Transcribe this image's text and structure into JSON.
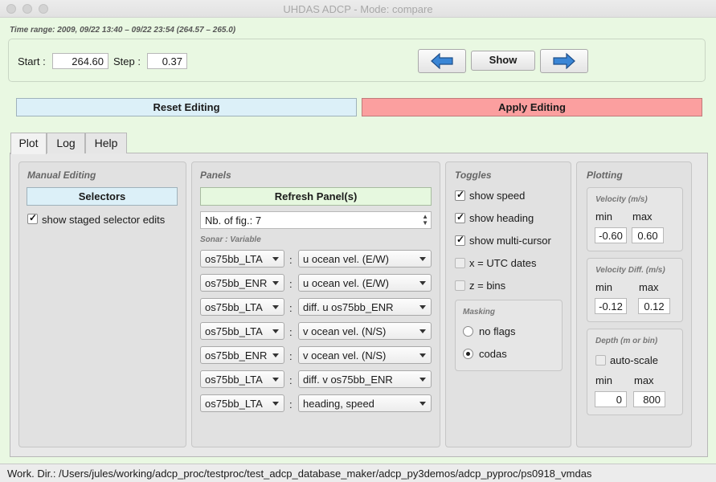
{
  "window": {
    "title": "UHDAS ADCP - Mode: compare"
  },
  "time_range": "Time range: 2009, 09/22 13:40 – 09/22 23:54 (264.57 – 265.0)",
  "nav": {
    "start_label": "Start :",
    "start_value": "264.60",
    "step_label": "Step :",
    "step_value": "0.37",
    "prev_icon": "left-arrow-icon",
    "show_label": "Show",
    "next_icon": "right-arrow-icon"
  },
  "actions": {
    "reset_label": "Reset Editing",
    "apply_label": "Apply Editing"
  },
  "tabs": [
    "Plot",
    "Log",
    "Help"
  ],
  "manual_editing": {
    "title": "Manual Editing",
    "selectors_label": "Selectors",
    "staged_label": "show staged selector edits",
    "staged_checked": true
  },
  "panels": {
    "title": "Panels",
    "refresh_label": "Refresh Panel(s)",
    "nb_fig": "Nb. of fig.: 7",
    "header": "Sonar  :  Variable",
    "rows": [
      {
        "sonar": "os75bb_LTA",
        "variable": "u ocean vel. (E/W)"
      },
      {
        "sonar": "os75bb_ENR",
        "variable": "u ocean vel. (E/W)"
      },
      {
        "sonar": "os75bb_LTA",
        "variable": "diff.  u os75bb_ENR"
      },
      {
        "sonar": "os75bb_LTA",
        "variable": "v ocean vel. (N/S)"
      },
      {
        "sonar": "os75bb_ENR",
        "variable": "v ocean vel. (N/S)"
      },
      {
        "sonar": "os75bb_LTA",
        "variable": "diff.  v os75bb_ENR"
      },
      {
        "sonar": "os75bb_LTA",
        "variable": "heading, speed"
      }
    ]
  },
  "toggles": {
    "title": "Toggles",
    "items": [
      {
        "label": "show speed",
        "checked": true
      },
      {
        "label": "show heading",
        "checked": true
      },
      {
        "label": "show multi-cursor",
        "checked": true
      },
      {
        "label": "x = UTC dates",
        "checked": false
      },
      {
        "label": "z = bins",
        "checked": false
      }
    ],
    "masking": {
      "title": "Masking",
      "options": [
        {
          "label": "no flags",
          "selected": false
        },
        {
          "label": "codas",
          "selected": true
        }
      ]
    }
  },
  "plotting": {
    "title": "Plotting",
    "velocity": {
      "title": "Velocity (m/s)",
      "min_label": "min",
      "max_label": "max",
      "min": "-0.60",
      "max": "0.60"
    },
    "velocity_diff": {
      "title": "Velocity Diff. (m/s)",
      "min_label": "min",
      "max_label": "max",
      "min": "-0.12",
      "max": "0.12"
    },
    "depth": {
      "title": "Depth (m or bin)",
      "autoscale_label": "auto-scale",
      "autoscale_checked": false,
      "min_label": "min",
      "max_label": "max",
      "min": "0",
      "max": "800"
    }
  },
  "work_dir": "Work. Dir.: /Users/jules/working/adcp_proc/testproc/test_adcp_database_maker/adcp_py3demos/adcp_pyproc/ps0918_vmdas"
}
